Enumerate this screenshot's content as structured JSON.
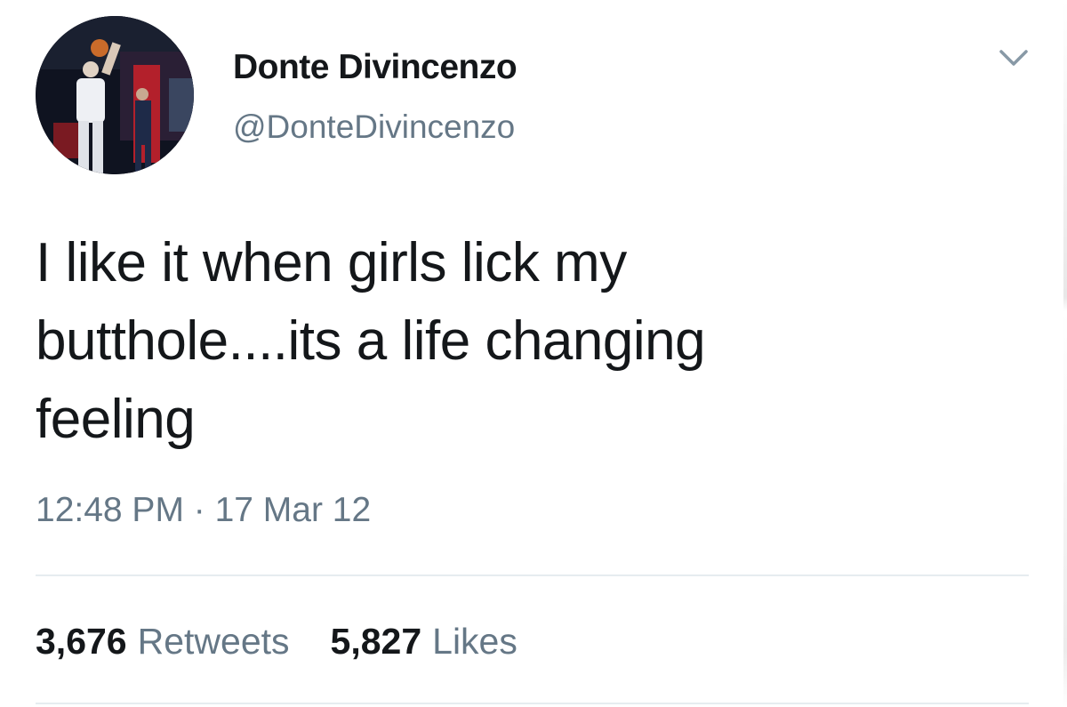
{
  "tweet": {
    "display_name": "Donte Divincenzo",
    "handle": "@DonteDivincenzo",
    "text": "I like it when girls lick my\nbutthole....its a life changing\nfeeling",
    "timestamp": "12:48 PM · 17 Mar 12",
    "retweets": {
      "count": "3,676",
      "label": "Retweets"
    },
    "likes": {
      "count": "5,827",
      "label": "Likes"
    },
    "menu_icon": "chevron-down-icon",
    "avatar_icon": "basketball-player-photo"
  },
  "colors": {
    "text": "#14171a",
    "secondary": "#657786",
    "divider": "#e6ecf0",
    "background": "#ffffff"
  }
}
